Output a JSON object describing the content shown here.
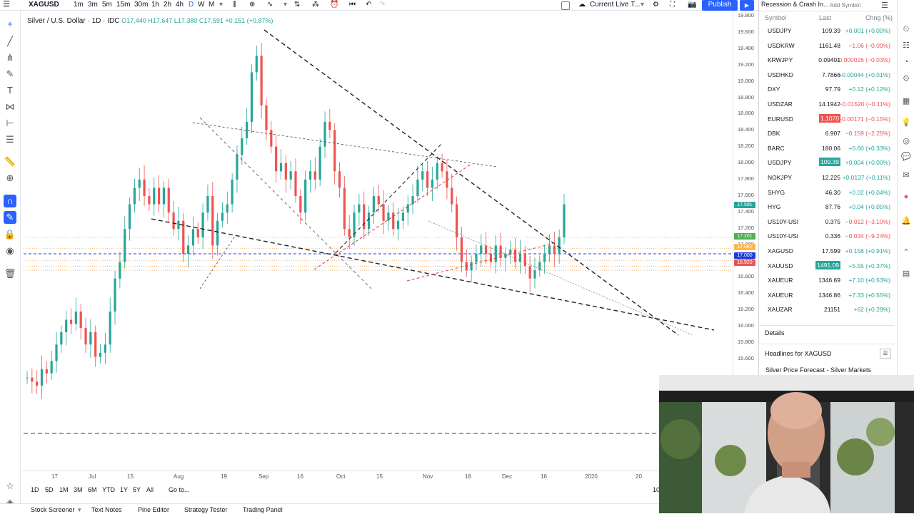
{
  "toolbar": {
    "symbol": "XAGUSD",
    "intervals": [
      "1m",
      "3m",
      "5m",
      "15m",
      "30m",
      "1h",
      "2h",
      "4h",
      "D",
      "W",
      "M"
    ],
    "active_interval": "D",
    "layout_name": "Current Live T...",
    "publish_label": "Publish"
  },
  "chart": {
    "title": "Silver / U.S. Dollar · 1D · IDC",
    "ohlc": "O17.440 H17.647 L17.380 C17.591 +0.151 (+0.87%)",
    "price_ticks": [
      "19.800",
      "19.600",
      "19.400",
      "19.200",
      "19.000",
      "18.800",
      "18.600",
      "18.400",
      "18.200",
      "18.000",
      "17.800",
      "17.600",
      "17.400",
      "17.200",
      "17.000",
      "16.800",
      "16.600",
      "16.400",
      "16.200",
      "16.000",
      "15.800",
      "15.600"
    ],
    "price_tags": [
      {
        "label": "17.591",
        "color": "#26a69a"
      },
      {
        "label": "17.201",
        "color": "#4caf50"
      },
      {
        "label": "17.067",
        "color": "#ffb74d"
      },
      {
        "label": "17.000",
        "color": "#1e3bd6"
      },
      {
        "label": "16.920",
        "color": "#ef5350"
      }
    ],
    "time_ticks": [
      "17",
      "Jul",
      "15",
      "Aug",
      "19",
      "Sep",
      "16",
      "Oct",
      "15",
      "Nov",
      "18",
      "Dec",
      "16",
      "2020",
      "20"
    ],
    "ranges": [
      "1D",
      "5D",
      "1M",
      "3M",
      "6M",
      "YTD",
      "1Y",
      "5Y",
      "All"
    ],
    "goto_label": "Go to...",
    "time_right": "10"
  },
  "bottom_tabs": [
    "Stock Screener",
    "Text Notes",
    "Pine Editor",
    "Strategy Tester",
    "Trading Panel"
  ],
  "watchlist": {
    "title": "Recession & Crash In...",
    "add_symbol": "Add Symbol",
    "col_symbol": "Symbol",
    "col_last": "Last",
    "col_chg": "Chng (%)",
    "rows": [
      {
        "symbol": "USDJPY",
        "last": "109.39",
        "chg": "+0.001 (+0.00%)",
        "dir": "up",
        "hl": ""
      },
      {
        "symbol": "USDKRW",
        "last": "1161.48",
        "chg": "−1.06 (−0.09%)",
        "dir": "dn",
        "hl": ""
      },
      {
        "symbol": "KRWJPY",
        "last": "0.09401",
        "chg": "−0.000026 (−0.03%)",
        "dir": "dn",
        "hl": ""
      },
      {
        "symbol": "USDHKD",
        "last": "7.7866",
        "chg": "+0.00044 (+0.01%)",
        "dir": "up",
        "hl": ""
      },
      {
        "symbol": "DXY",
        "last": "97.79",
        "chg": "+0.12 (+0.12%)",
        "dir": "up",
        "hl": ""
      },
      {
        "symbol": "USDZAR",
        "last": "14.1942",
        "chg": "−0.01520 (−0.11%)",
        "dir": "dn",
        "hl": ""
      },
      {
        "symbol": "EURUSD",
        "last": "1.1070",
        "chg": "−0.00171 (−0.15%)",
        "dir": "dn",
        "hl": "red"
      },
      {
        "symbol": "DBK",
        "last": "6.907",
        "chg": "−0.159 (−2.25%)",
        "dir": "dn",
        "hl": ""
      },
      {
        "symbol": "BARC",
        "last": "180.06",
        "chg": "+0.60 (+0.33%)",
        "dir": "up",
        "hl": ""
      },
      {
        "symbol": "USDJPY",
        "last": "109.39",
        "chg": "+0.004 (+0.00%)",
        "dir": "up",
        "hl": "green"
      },
      {
        "symbol": "NOKJPY",
        "last": "12.225",
        "chg": "+0.0137 (+0.11%)",
        "dir": "up",
        "hl": ""
      },
      {
        "symbol": "SHYG",
        "last": "46.30",
        "chg": "+0.02 (+0.04%)",
        "dir": "up",
        "hl": ""
      },
      {
        "symbol": "HYG",
        "last": "87.76",
        "chg": "+0.04 (+0.05%)",
        "dir": "up",
        "hl": ""
      },
      {
        "symbol": "US10Y-USI",
        "last": "0.375",
        "chg": "−0.012 (−3.10%)",
        "dir": "dn",
        "hl": ""
      },
      {
        "symbol": "US10Y-USI",
        "last": "0.336",
        "chg": "−0.034 (−9.24%)",
        "dir": "dn",
        "hl": ""
      },
      {
        "symbol": "XAGUSD",
        "last": "17.599",
        "chg": "+0.158 (+0.91%)",
        "dir": "up",
        "hl": ""
      },
      {
        "symbol": "XAUUSD",
        "last": "1491.09",
        "chg": "+5.55 (+0.37%)",
        "dir": "up",
        "hl": "green"
      },
      {
        "symbol": "XAUEUR",
        "last": "1346.69",
        "chg": "+7.10 (+0.53%)",
        "dir": "up",
        "hl": ""
      },
      {
        "symbol": "XAUEUR",
        "last": "1346.86",
        "chg": "+7.33 (+0.55%)",
        "dir": "up",
        "hl": ""
      },
      {
        "symbol": "XAUZAR",
        "last": "21151",
        "chg": "+62 (+0.29%)",
        "dir": "up",
        "hl": ""
      }
    ],
    "details_label": "Details",
    "headlines_label": "Headlines for XAGUSD",
    "headline_1": "Silver Price Forecast - Silver Markets"
  },
  "colors": {
    "up": "#26a69a",
    "down": "#ef5350",
    "accent": "#2962ff"
  }
}
